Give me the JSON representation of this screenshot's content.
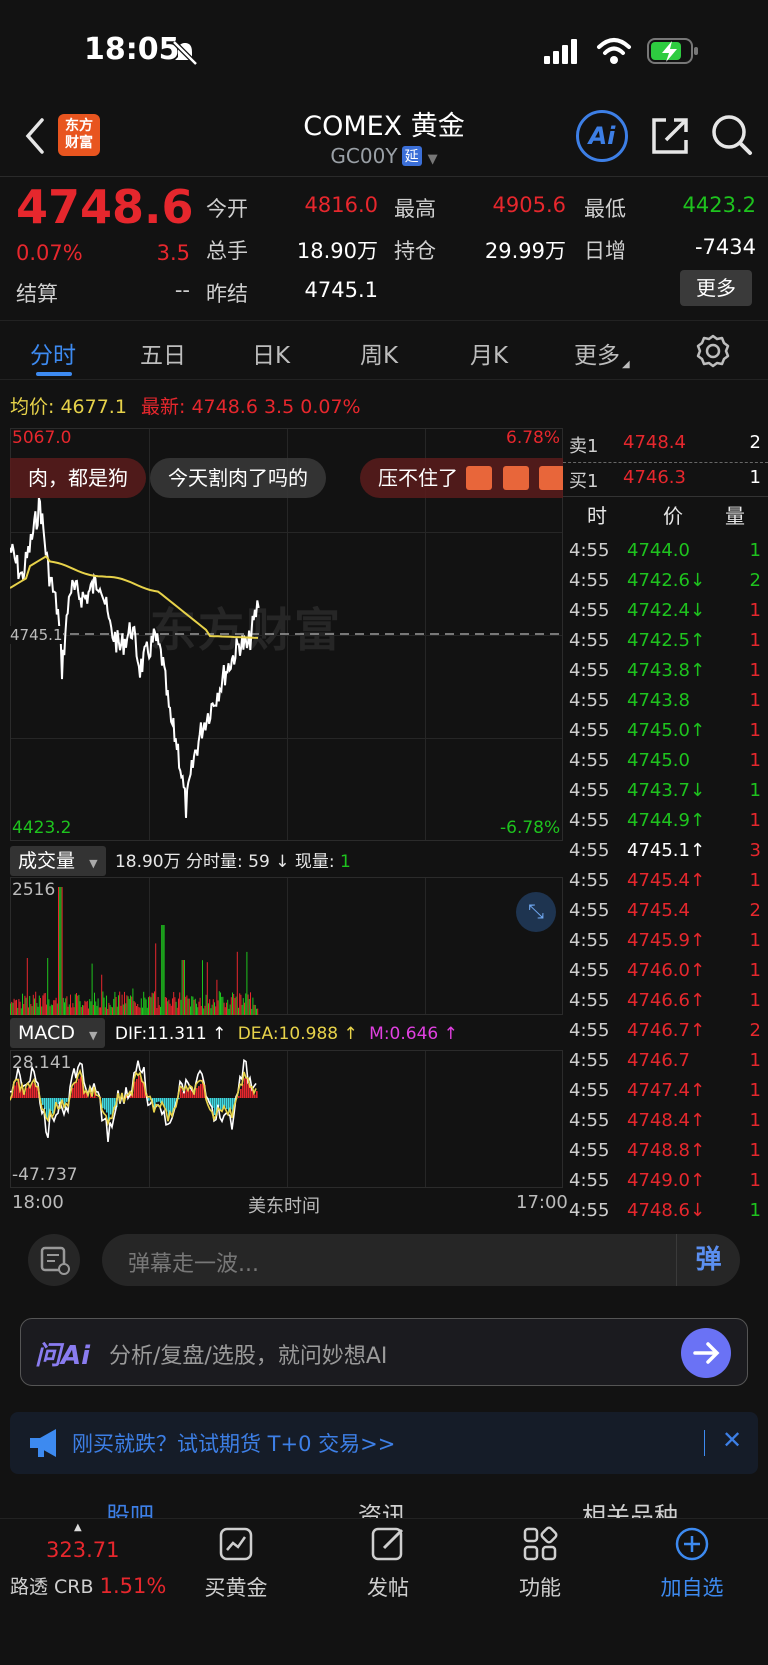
{
  "status_bar": {
    "time": "18:05"
  },
  "header": {
    "logo_text": "东方\n财富",
    "title": "COMEX 黄金",
    "code": "GC00Y",
    "code_badge": "延",
    "ai_label": "Ai"
  },
  "quote": {
    "price": "4748.6",
    "change_pct": "0.07%",
    "change": "3.5",
    "settle_label": "结算",
    "settle_value": "--",
    "open_label": "今开",
    "open_value": "4816.0",
    "high_label": "最高",
    "high_value": "4905.6",
    "low_label": "最低",
    "low_value": "4423.2",
    "volume_label": "总手",
    "volume_value": "18.90万",
    "oi_label": "持仓",
    "oi_value": "29.99万",
    "daily_inc_label": "日增",
    "daily_inc_value": "-7434",
    "prev_settle_label": "昨结",
    "prev_settle_value": "4745.1",
    "more_button": "更多"
  },
  "tabs": [
    {
      "label": "分时"
    },
    {
      "label": "五日"
    },
    {
      "label": "日K"
    },
    {
      "label": "周K"
    },
    {
      "label": "月K"
    },
    {
      "label": "更多"
    }
  ],
  "intraday": {
    "avg_label": "均价:",
    "avg_value": "4677.1",
    "latest_label": "最新:",
    "latest_value": "4748.6",
    "latest_change": "3.5",
    "latest_pct": "0.07%",
    "top_price": "5067.0",
    "top_pct": "6.78%",
    "bottom_price": "4423.2",
    "bottom_pct": "-6.78%",
    "ref_price": "4745.1",
    "watermark": "东方财富",
    "time_start": "18:00",
    "time_mid": "美东时间",
    "time_end": "17:00"
  },
  "danmu": [
    "肉，都是狗",
    "今天割肉了吗的",
    "压不住了"
  ],
  "order_book": {
    "ask_label": "卖1",
    "ask_price": "4748.4",
    "ask_qty": "2",
    "bid_label": "买1",
    "bid_price": "4746.3",
    "bid_qty": "1",
    "col_time": "时",
    "col_price": "价",
    "col_qty": "量"
  },
  "ticks": [
    {
      "t": "4:55",
      "p": "4744.0",
      "d": "",
      "q": "1",
      "c": "green",
      "qc": "green"
    },
    {
      "t": "4:55",
      "p": "4742.6",
      "d": "↓",
      "q": "2",
      "c": "green",
      "qc": "green"
    },
    {
      "t": "4:55",
      "p": "4742.4",
      "d": "↓",
      "q": "1",
      "c": "green",
      "qc": "red"
    },
    {
      "t": "4:55",
      "p": "4742.5",
      "d": "↑",
      "q": "1",
      "c": "green",
      "qc": "red"
    },
    {
      "t": "4:55",
      "p": "4743.8",
      "d": "↑",
      "q": "1",
      "c": "green",
      "qc": "red"
    },
    {
      "t": "4:55",
      "p": "4743.8",
      "d": "",
      "q": "1",
      "c": "green",
      "qc": "red"
    },
    {
      "t": "4:55",
      "p": "4745.0",
      "d": "↑",
      "q": "1",
      "c": "green",
      "qc": "red"
    },
    {
      "t": "4:55",
      "p": "4745.0",
      "d": "",
      "q": "1",
      "c": "green",
      "qc": "red"
    },
    {
      "t": "4:55",
      "p": "4743.7",
      "d": "↓",
      "q": "1",
      "c": "green",
      "qc": "green"
    },
    {
      "t": "4:55",
      "p": "4744.9",
      "d": "↑",
      "q": "1",
      "c": "green",
      "qc": "red"
    },
    {
      "t": "4:55",
      "p": "4745.1",
      "d": "↑",
      "q": "3",
      "c": "white",
      "qc": "red"
    },
    {
      "t": "4:55",
      "p": "4745.4",
      "d": "↑",
      "q": "1",
      "c": "red",
      "qc": "red"
    },
    {
      "t": "4:55",
      "p": "4745.4",
      "d": "",
      "q": "2",
      "c": "red",
      "qc": "red"
    },
    {
      "t": "4:55",
      "p": "4745.9",
      "d": "↑",
      "q": "1",
      "c": "red",
      "qc": "red"
    },
    {
      "t": "4:55",
      "p": "4746.0",
      "d": "↑",
      "q": "1",
      "c": "red",
      "qc": "red"
    },
    {
      "t": "4:55",
      "p": "4746.6",
      "d": "↑",
      "q": "1",
      "c": "red",
      "qc": "red"
    },
    {
      "t": "4:55",
      "p": "4746.7",
      "d": "↑",
      "q": "2",
      "c": "red",
      "qc": "red"
    },
    {
      "t": "4:55",
      "p": "4746.7",
      "d": "",
      "q": "1",
      "c": "red",
      "qc": "red"
    },
    {
      "t": "4:55",
      "p": "4747.4",
      "d": "↑",
      "q": "1",
      "c": "red",
      "qc": "red"
    },
    {
      "t": "4:55",
      "p": "4748.4",
      "d": "↑",
      "q": "1",
      "c": "red",
      "qc": "red"
    },
    {
      "t": "4:55",
      "p": "4748.8",
      "d": "↑",
      "q": "1",
      "c": "red",
      "qc": "red"
    },
    {
      "t": "4:55",
      "p": "4749.0",
      "d": "↑",
      "q": "1",
      "c": "red",
      "qc": "red"
    },
    {
      "t": "4:55",
      "p": "4748.6",
      "d": "↓",
      "q": "1",
      "c": "red",
      "qc": "green"
    }
  ],
  "volume": {
    "selector": "成交量",
    "total": "18.90万",
    "tick_vol_label": "分时量:",
    "tick_vol": "59",
    "tick_arrow": "↓",
    "now_label": "现量:",
    "now_value": "1",
    "max": "2516"
  },
  "macd": {
    "selector": "MACD",
    "dif": "DIF:11.311 ↑",
    "dea": "DEA:10.988 ↑",
    "m": "M:0.646 ↑",
    "max": "28.141",
    "min": "-47.737"
  },
  "danmu_input": {
    "placeholder": "弹幕走一波...",
    "send": "弹"
  },
  "ai_input": {
    "brand": "问Ai",
    "placeholder": "分析/复盘/选股，就问妙想AI"
  },
  "notice": {
    "text": "刚买就跌？试试期货 T+0 交易>>"
  },
  "section_tabs": [
    "股吧",
    "资讯",
    "相关品种"
  ],
  "bottom_nav": {
    "index_value": "323.71",
    "index_name": "路透 CRB",
    "index_pct": "1.51%",
    "items": [
      {
        "label": "买黄金"
      },
      {
        "label": "发帖"
      },
      {
        "label": "功能"
      },
      {
        "label": "加自选"
      }
    ]
  },
  "colors": {
    "up": "#e6272d",
    "down": "#1ec31e",
    "accent": "#3d8af0",
    "avg_line": "#e7d24a"
  }
}
